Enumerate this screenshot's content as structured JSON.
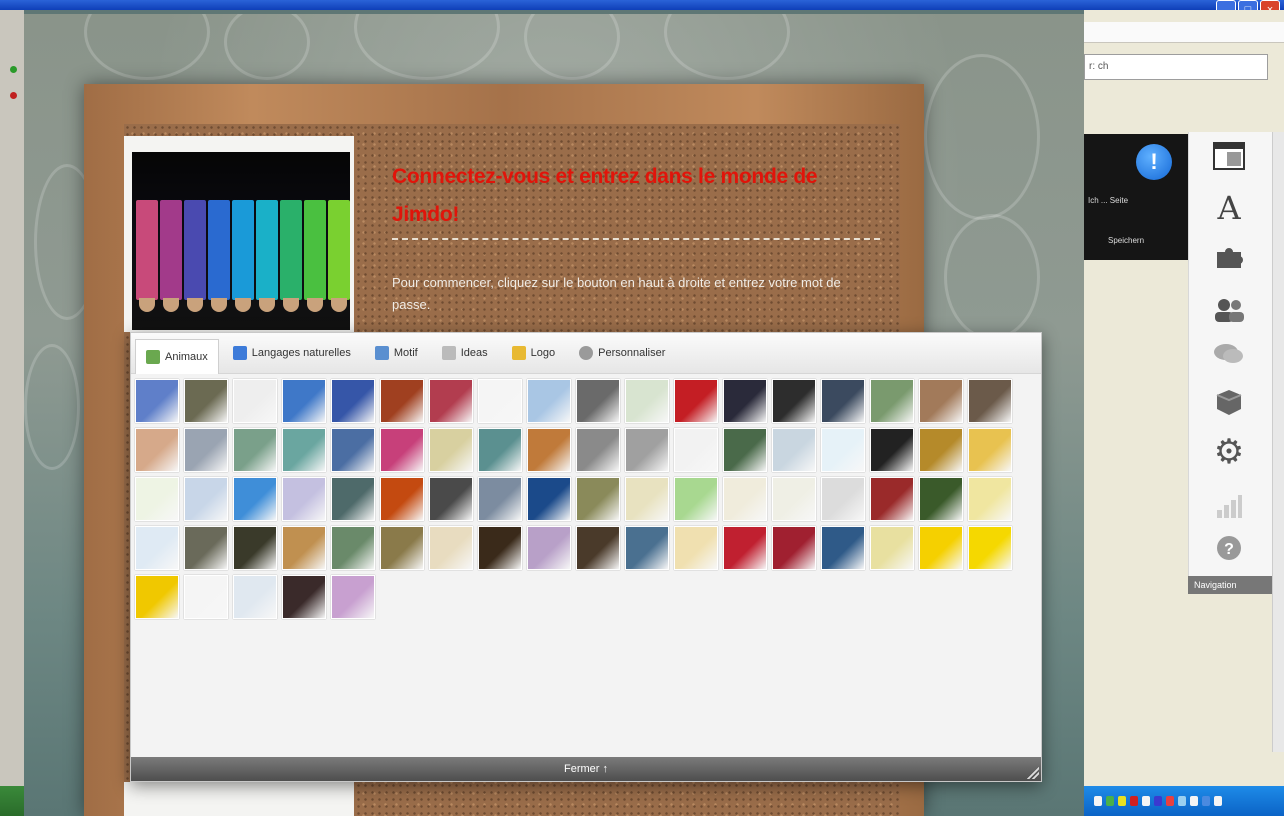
{
  "board": {
    "headline": "Connectez-vous et entrez dans le monde de Jimdo!",
    "subtext": "Pour commencer, cliquez sur le bouton en haut à droite et entrez votre mot de passe."
  },
  "gallery": {
    "tabs": [
      {
        "label": "Animaux",
        "icon": "paw-icon",
        "color": "#6aa84f"
      },
      {
        "label": "Langages naturelles",
        "icon": "pencil-icon",
        "color": "#3d7bd9"
      },
      {
        "label": "Motif",
        "icon": "image-icon",
        "color": "#5a8fd0"
      },
      {
        "label": "Ideas",
        "icon": "page-icon",
        "color": "#bbbbbb"
      },
      {
        "label": "Logo",
        "icon": "folder-icon",
        "color": "#e8b932"
      },
      {
        "label": "Personnaliser",
        "icon": "user-icon",
        "color": "#9a9a9a"
      }
    ],
    "footer_label": "Fermer ↑",
    "thumbnails": [
      "#5f7fc9",
      "#6b6a52",
      "#eeeeee",
      "#3f78c8",
      "#3656a8",
      "#a04020",
      "#b23d4f",
      "#f5f5f5",
      "#a9c6e4",
      "#6a6a6a",
      "#d8e4d0",
      "#c41e24",
      "#2a2a3a",
      "#2d2d2d",
      "#3b4a5f",
      "#7a9a6e",
      "#a27a5a",
      "#6b5a4a",
      "#d6a98a",
      "#9aa4b2",
      "#7aa08a",
      "#6aa6a0",
      "#4b6ea3",
      "#c7407a",
      "#d8d0a0",
      "#5b9090",
      "#c07a3a",
      "#8a8a8a",
      "#a0a0a0",
      "#f2f2f2",
      "#4a6a4a",
      "#c9d6e0",
      "#e6f2f8",
      "#222222",
      "#b58a2a",
      "#e8c250",
      "#eef4e4",
      "#c8d6e8",
      "#3f8ed8",
      "#c4c0e0",
      "#4e6a6a",
      "#c44a10",
      "#4a4a4a",
      "#7c8ca0",
      "#1b4a8a",
      "#8a8a5a",
      "#e8e2c0",
      "#a8d890",
      "#f0ecdc",
      "#efefe5",
      "#dcdcdc",
      "#9a2a2a",
      "#3a5a2a",
      "#f0e6a0",
      "#dfeaf4",
      "#6a6a5a",
      "#3a3a2a",
      "#c09050",
      "#6a8a6a",
      "#8a7a4a",
      "#e8dcc0",
      "#3a2a1a",
      "#b8a0c8",
      "#4a3a2a",
      "#4a7090",
      "#f0e0b0",
      "#c02030",
      "#a02030",
      "#2f5a88",
      "#e8e0a0",
      "#f5d000",
      "#f5d800",
      "#f0c800",
      "#f5f5f5",
      "#e0e8f0",
      "#3a2a2a",
      "#c8a0d0"
    ]
  },
  "right_panel": {
    "address_text": "r: ch",
    "dark_panel_text1": "Ich ... Seite",
    "dark_panel_text2": "Speichern",
    "toolbar_footer": "Navigation",
    "tools": [
      {
        "name": "layout-icon",
        "glyph": "▣"
      },
      {
        "name": "font-icon",
        "glyph": "A"
      },
      {
        "name": "puzzle-icon",
        "glyph": "✦"
      },
      {
        "name": "users-icon",
        "glyph": "👥"
      },
      {
        "name": "chat-icon",
        "glyph": "💬"
      },
      {
        "name": "box-icon",
        "glyph": "▤"
      },
      {
        "name": "gear-icon",
        "glyph": "⚙"
      },
      {
        "name": "stats-icon",
        "glyph": "▮"
      },
      {
        "name": "help-icon",
        "glyph": "?"
      }
    ]
  }
}
